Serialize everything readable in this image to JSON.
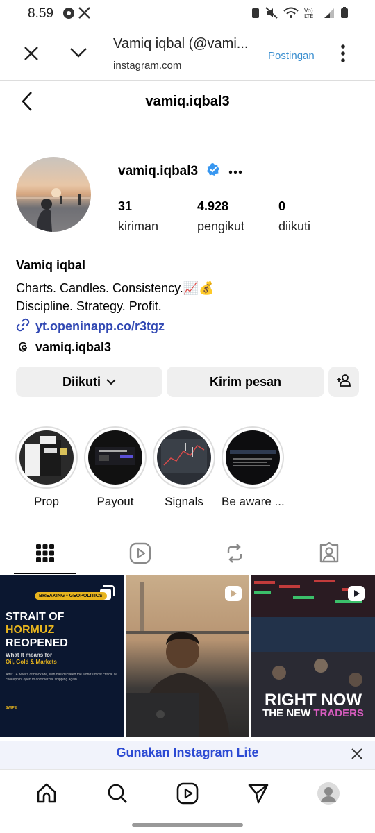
{
  "status_bar": {
    "time": "8.59"
  },
  "webview": {
    "title": "Vamiq iqbal (@vami...",
    "url": "instagram.com",
    "post_label": "Postingan"
  },
  "header": {
    "username": "vamiq.iqbal3"
  },
  "profile": {
    "username": "vamiq.iqbal3",
    "verified": true,
    "stats": [
      {
        "value": "31",
        "label": "kiriman"
      },
      {
        "value": "4.928",
        "label": "pengikut"
      },
      {
        "value": "0",
        "label": "diikuti"
      }
    ],
    "full_name": "Vamiq iqbal",
    "bio_line1": "Charts. Candles. Consistency.📈💰",
    "bio_line2": "Discipline. Strategy. Profit.",
    "link": "yt.openinapp.co/r3tgz",
    "threads_handle": "vamiq.iqbal3"
  },
  "actions": {
    "following_label": "Diikuti",
    "message_label": "Kirim pesan"
  },
  "highlights": [
    {
      "label": "Prop"
    },
    {
      "label": "Payout"
    },
    {
      "label": "Signals"
    },
    {
      "label": "Be aware ..."
    }
  ],
  "posts": {
    "post1": {
      "tag": "BREAKING • GEOPOLITICS",
      "headline_1": "STRAIT OF",
      "headline_2": "HORMUZ",
      "headline_3": "REOPENED",
      "subhead": "What It means for",
      "subhead_2": "Oil, Gold & Markets",
      "body": "After 74 weeks of blockade, Iran has declared the world's most critical oil chokepoint open to commercial shipping again.",
      "swipe": "SWIPE"
    },
    "post3": {
      "line1": "RIGHT NOW",
      "line2a": "THE NEW ",
      "line2b": "TRADERS"
    }
  },
  "lite_banner": {
    "text": "Gunakan Instagram Lite"
  },
  "colors": {
    "accent_blue": "#3b8fd0",
    "link_blue": "#3148b3",
    "verified_blue": "#3897f0"
  }
}
